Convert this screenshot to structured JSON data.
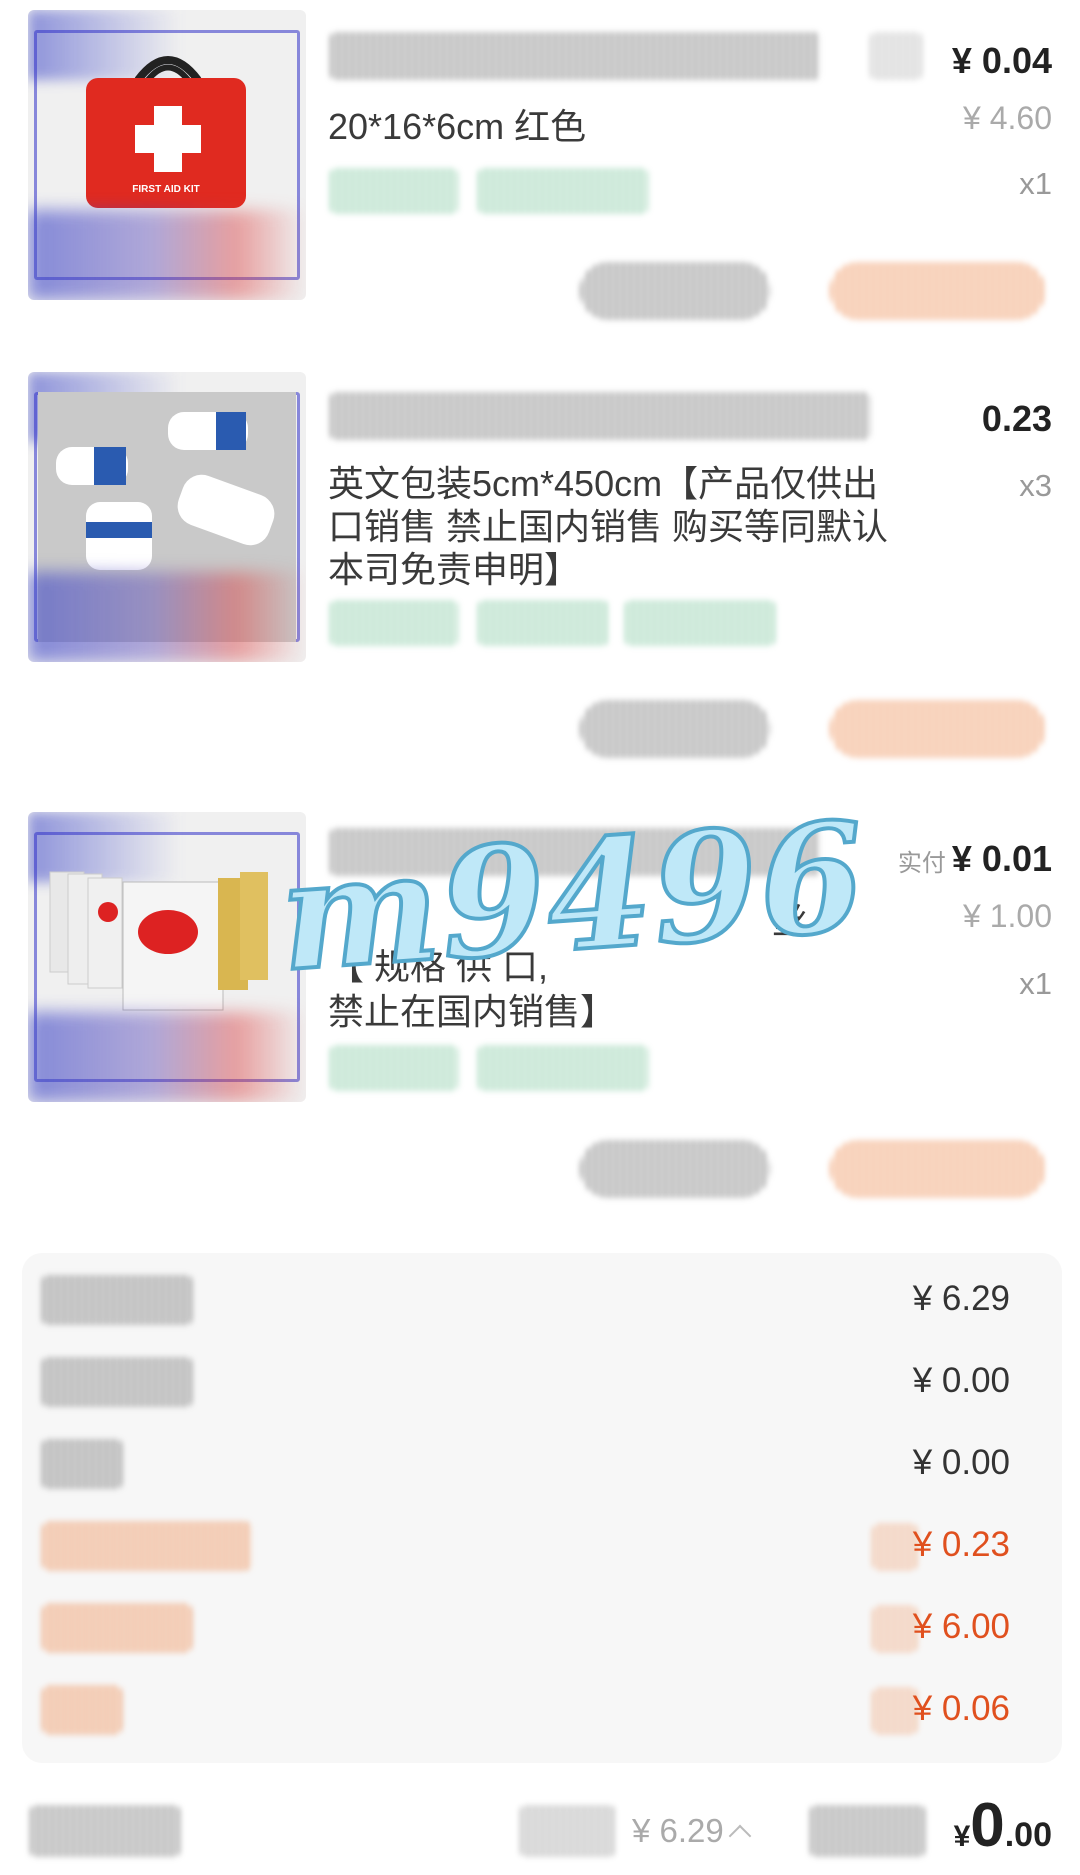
{
  "items": [
    {
      "variant": "20*16*6cm 红色",
      "price": "¥ 0.04",
      "original_price": "¥ 4.60",
      "qty": "x1",
      "image": "red-first-aid-kit-bag",
      "image_text": "FIRST AID KIT"
    },
    {
      "variant": "英文包装5cm*450cm【产品仅供出口销售 禁止国内销售 购买等同默认本司免责申明】",
      "price": "0.23",
      "qty": "x3",
      "image": "gauze-bandage-rolls"
    },
    {
      "variant_line1": "丝",
      "variant_line2": "【 规格 供 口,",
      "variant_line3": "禁止在国内销售】",
      "paid_label": "实付",
      "price": "¥ 0.01",
      "original_price": "¥ 1.00",
      "qty": "x1",
      "image": "emergency-blanket-packs"
    }
  ],
  "summary": {
    "values": [
      "¥ 6.29",
      "¥ 0.00",
      "¥ 0.00",
      "¥ 0.23",
      "¥ 6.00",
      "¥ 0.06"
    ],
    "value_colors": [
      "#333333",
      "#333333",
      "#333333",
      "#e0501e",
      "#e0501e",
      "#e0501e"
    ]
  },
  "watermark": "m9496",
  "footer": {
    "original_total": "¥ 6.29",
    "pay_currency": "¥",
    "pay_integer": "0",
    "pay_decimal": ".00"
  }
}
